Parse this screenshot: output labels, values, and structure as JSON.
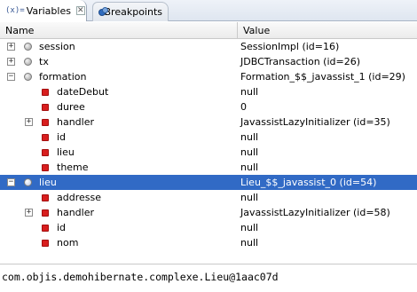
{
  "tabs": {
    "variables": {
      "icon_text": "(x)=",
      "label": "Variables",
      "close_glyph": "✕"
    },
    "breakpoints": {
      "label": "Breakpoints"
    }
  },
  "columns": {
    "name": "Name",
    "value": "Value"
  },
  "rows": [
    {
      "name": "session",
      "value": "SessionImpl  (id=16)",
      "expander": "+",
      "icon": "object",
      "selected": false
    },
    {
      "name": "tx",
      "value": "JDBCTransaction  (id=26)",
      "expander": "+",
      "icon": "object",
      "selected": false
    },
    {
      "name": "formation",
      "value": "Formation_$$_javassist_1  (id=29)",
      "expander": "−",
      "icon": "object",
      "selected": false
    },
    {
      "name": "dateDebut",
      "value": "null",
      "expander": "",
      "icon": "field",
      "selected": false
    },
    {
      "name": "duree",
      "value": "0",
      "expander": "",
      "icon": "field",
      "selected": false
    },
    {
      "name": "handler",
      "value": "JavassistLazyInitializer  (id=35)",
      "expander": "+",
      "icon": "field",
      "selected": false
    },
    {
      "name": "id",
      "value": "null",
      "expander": "",
      "icon": "field",
      "selected": false
    },
    {
      "name": "lieu",
      "value": "null",
      "expander": "",
      "icon": "field",
      "selected": false
    },
    {
      "name": "theme",
      "value": "null",
      "expander": "",
      "icon": "field",
      "selected": false
    },
    {
      "name": "lieu",
      "value": "Lieu_$$_javassist_0  (id=54)",
      "expander": "−",
      "icon": "object",
      "selected": true
    },
    {
      "name": "addresse",
      "value": "null",
      "expander": "",
      "icon": "field",
      "selected": false
    },
    {
      "name": "handler",
      "value": "JavassistLazyInitializer  (id=58)",
      "expander": "+",
      "icon": "field",
      "selected": false
    },
    {
      "name": "id",
      "value": "null",
      "expander": "",
      "icon": "field",
      "selected": false
    },
    {
      "name": "nom",
      "value": "null",
      "expander": "",
      "icon": "field",
      "selected": false
    }
  ],
  "detail_pane": {
    "text": "com.objis.demohibernate.complexe.Lieu@1aac07d"
  },
  "colors": {
    "selection": "#316ac5",
    "field_icon": "#d81e1e"
  }
}
